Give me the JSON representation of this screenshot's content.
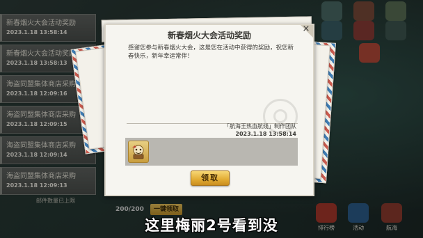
{
  "mail_list": {
    "items": [
      {
        "title": "新春烟火大会活动奖励",
        "date": "2023.1.18 13:58:14"
      },
      {
        "title": "新春烟火大会活动奖励",
        "date": "2023.1.18 13:58:13"
      },
      {
        "title": "海盗同盟集体商店采购",
        "date": "2023.1.18 12:09:16"
      },
      {
        "title": "海盗同盟集体商店采购",
        "date": "2023.1.18 12:09:15"
      },
      {
        "title": "海盗同盟集体商店采购",
        "date": "2023.1.18 12:09:14"
      },
      {
        "title": "海盗同盟集体商店采购",
        "date": "2023.1.18 12:09:13"
      }
    ],
    "footer": "邮件数量已上限"
  },
  "bottom_bar": {
    "counter": "200/200",
    "collect_all_label": "一键领取"
  },
  "side_icons": [
    {
      "label": "排行榜",
      "icon": "trophy-icon",
      "color": "#c0392b"
    },
    {
      "label": "活动",
      "icon": "event-icon",
      "color": "#2c5d8a"
    },
    {
      "label": "航海",
      "icon": "ship-icon",
      "color": "#8e3b2f"
    }
  ],
  "dialog": {
    "title": "新春烟火大会活动奖励",
    "body": "感谢您参与新春烟火大会，这是您在活动中获得的奖励，祝您新春快乐，新年幸运常伴！",
    "signature": "「航海王热血航线」制作团队",
    "date": "2023.1.18  13:58:14",
    "collect_label": "领取",
    "close_symbol": "×",
    "attachment_icon": "item-box-icon"
  },
  "subtitle": "这里梅丽2号看到没",
  "colors": {
    "accent_gold": "#e2ac33",
    "dialog_bg": "#f6f5f0",
    "envelope_red": "#c95a4e",
    "envelope_blue": "#3f7cb3"
  }
}
